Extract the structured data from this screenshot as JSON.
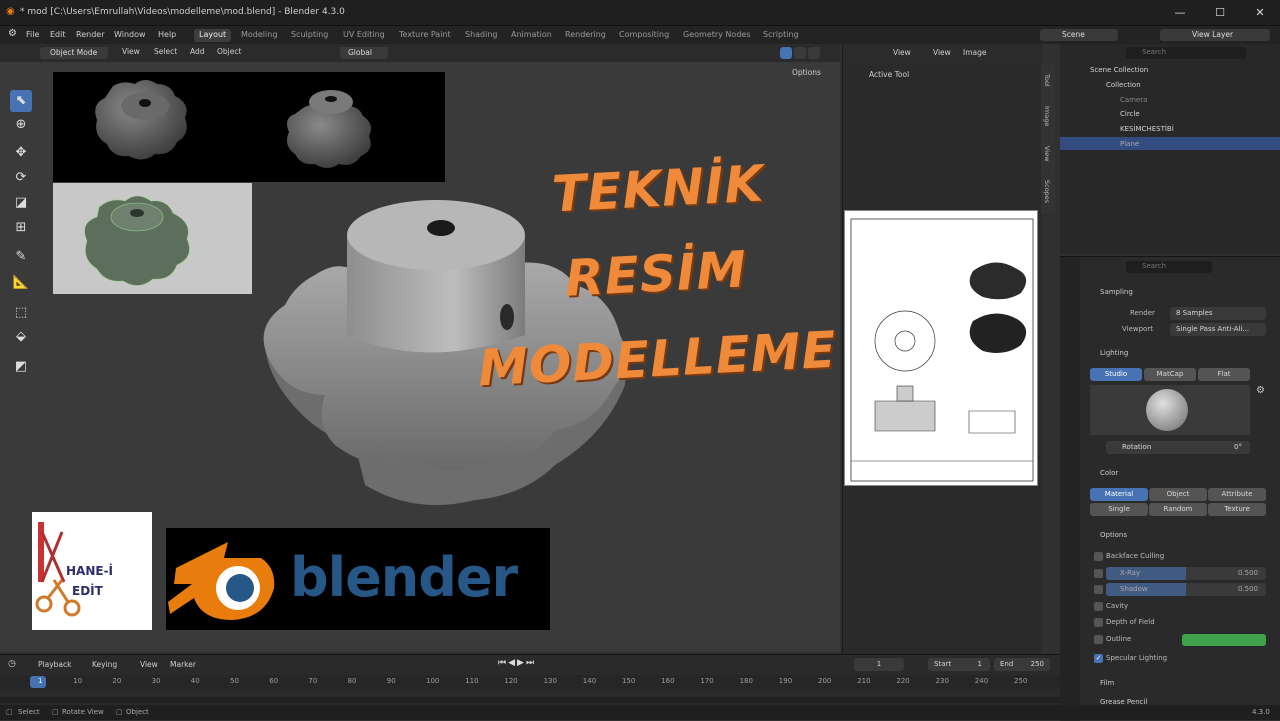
{
  "window": {
    "title": "* mod [C:\\Users\\Emrullah\\Videos\\modelleme\\mod.blend] - Blender 4.3.0",
    "minimize": "—",
    "maximize": "☐",
    "close": "✕"
  },
  "menubar": {
    "items": [
      "File",
      "Edit",
      "Render",
      "Window",
      "Help"
    ],
    "workspaces": [
      "Layout",
      "Modeling",
      "Sculpting",
      "UV Editing",
      "Texture Paint",
      "Shading",
      "Animation",
      "Rendering",
      "Compositing",
      "Geometry Nodes",
      "Scripting"
    ],
    "scene": "Scene",
    "view_layer": "View Layer"
  },
  "viewport_header": {
    "mode": "Object Mode",
    "view": "View",
    "select": "Select",
    "add": "Add",
    "object": "Object",
    "transform": "Global",
    "options": "Options"
  },
  "overlay": {
    "headline": [
      "TEKNİK",
      "RESİM",
      "MODELLEME"
    ],
    "brand_logo_text": "blender",
    "channel_logo_text": [
      "HANE-İ",
      "EDİT"
    ]
  },
  "image_editor": {
    "view": "View",
    "view2": "View",
    "image": "Image",
    "active_tool": "Active Tool",
    "side_tabs": [
      "Tool",
      "Image",
      "View",
      "Scopes"
    ]
  },
  "outliner": {
    "search_placeholder": "Search",
    "root": "Scene Collection",
    "collection": "Collection",
    "items": [
      {
        "name": "Camera"
      },
      {
        "name": "Circle"
      },
      {
        "name": "KESİMCHESTİBİ"
      },
      {
        "name": "Plane"
      }
    ]
  },
  "properties": {
    "search_placeholder": "Search",
    "sampling": {
      "header": "Sampling",
      "render_label": "Render",
      "render_value": "8 Samples",
      "viewport_label": "Viewport",
      "viewport_value": "Single Pass Anti-Ali..."
    },
    "lighting": {
      "header": "Lighting",
      "buttons": [
        "Studio",
        "MatCap",
        "Flat"
      ],
      "rotation_label": "Rotation",
      "rotation_value": "0°"
    },
    "color": {
      "header": "Color",
      "buttons": [
        "Material",
        "Object",
        "Attribute",
        "Single",
        "Random",
        "Texture"
      ]
    },
    "options": {
      "header": "Options",
      "backface": "Backface Culling",
      "xray": "X-Ray",
      "xray_value": "0.500",
      "shadow": "Shadow",
      "shadow_value": "0.500",
      "cavity": "Cavity",
      "dof": "Depth of Field",
      "outline": "Outline",
      "specular": "Specular Lighting"
    },
    "film": "Film",
    "grease": "Grease Pencil"
  },
  "timeline": {
    "playback": "Playback",
    "keying": "Keying",
    "view": "View",
    "marker": "Marker",
    "current_frame": "1",
    "start_label": "Start",
    "start": "1",
    "end_label": "End",
    "end": "250",
    "ticks": [
      "1",
      "10",
      "20",
      "30",
      "40",
      "50",
      "60",
      "70",
      "80",
      "90",
      "100",
      "110",
      "120",
      "130",
      "140",
      "150",
      "160",
      "170",
      "180",
      "190",
      "200",
      "210",
      "220",
      "230",
      "240",
      "250"
    ]
  },
  "statusbar": {
    "select": "Select",
    "rotate": "Rotate View",
    "object": "Object",
    "version": "4.3.0"
  },
  "colors": {
    "accent": "#4772b3",
    "headline": "#ef8a3b",
    "outline_color": "#3fa34d",
    "blender_orange": "#e87d0d",
    "blender_blue": "#265787"
  }
}
